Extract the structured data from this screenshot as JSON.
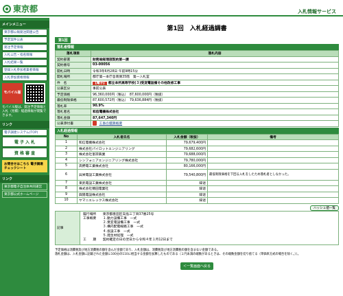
{
  "header": {
    "logo_text": "東京都",
    "service_title": "入札情報サービス"
  },
  "sidebar": {
    "menu_heading": "メインメニュー",
    "items": [
      "東京都公報発注関連公告",
      "予定案件公表",
      "発注予定情報",
      "入札公告・指名情報",
      "入札結果一覧",
      "登録入札参加者業者情報",
      "入札参加資格情報"
    ],
    "mobile_label": "モバイル版",
    "mobile_note": "モバイル版は、発注予定情報と入札（見積）経過情報が閲覧できます。",
    "links_heading": "リンク",
    "big_items": [
      "電子調達システム(TOP)",
      "電 子 入 札",
      "資 格 審 査"
    ],
    "check_label": "お問合せはこちら 電子調達チェックシート",
    "bottom_heading": "リンク",
    "bottom_links": [
      "東京都電子自治体共同運営",
      "東京都公式ホームページ"
    ]
  },
  "main": {
    "page_title": "第1回　入札経過調書",
    "tab_label": "第1回",
    "section_info": "落札者情報",
    "info_headers": [
      "落札項目",
      "落札内容"
    ],
    "info_rows": [
      {
        "k": "契約部署",
        "v": "財務局経理部契約第一課"
      },
      {
        "k": "契約番号",
        "v": "03-00056"
      },
      {
        "k": "開札日時",
        "v": "令和3年6月28日 午前9時15分"
      },
      {
        "k": "開札場所",
        "v": "都庁第一本庁舎南側35階　第一入札室"
      },
      {
        "k": "件　名",
        "badge": "【電子】",
        "v": "都立本所高等学校(３)受変電設備その他改修工事"
      },
      {
        "k": "公表区分",
        "v": "事前公表"
      },
      {
        "k": "予定価格",
        "v": "96,360,000円（税込）　87,600,000円（税抜）"
      },
      {
        "k": "最低制限価格",
        "v": "87,600,572円（税込）　79,636,884円（税抜）"
      },
      {
        "k": "落札率",
        "v": "90.9%"
      },
      {
        "k": "落札者名",
        "v": "和信電機株式会社"
      },
      {
        "k": "落札金額",
        "v": "87,647,340円"
      },
      {
        "k": "公表添付書",
        "v": "工事の積算概要"
      }
    ],
    "section_bids": "入札経過情報",
    "bid_headers": [
      "No",
      "入札者氏名",
      "入札金額（税抜）",
      "備考"
    ],
    "bids": [
      {
        "no": "1",
        "name": "和信電機株式会社",
        "amt": "79,679,400円",
        "note": ""
      },
      {
        "no": "2",
        "name": "株式会社パイロットエンジニアリング",
        "amt": "79,682,600円",
        "note": ""
      },
      {
        "no": "3",
        "name": "株式会社峯岸興業",
        "amt": "79,688,000円",
        "note": ""
      },
      {
        "no": "4",
        "name": "シンフォニアエンジニアリング株式会社",
        "amt": "79,780,000円",
        "note": ""
      },
      {
        "no": "5",
        "name": "高野電工業株式会社",
        "amt": "80,166,000円",
        "note": ""
      },
      {
        "no": "6",
        "name": "呉栄電設工業株式会社",
        "amt": "79,540,800円",
        "note": "最低制限価格を下回る入札をしたため落札者としなかった。"
      },
      {
        "no": "7",
        "name": "東武電設工業株式会社",
        "amt": "辞退",
        "note": ""
      },
      {
        "no": "8",
        "name": "株式会社穂田電業社",
        "amt": "辞退",
        "note": ""
      },
      {
        "no": "9",
        "name": "興陽電設株式会社",
        "amt": "辞退",
        "note": ""
      },
      {
        "no": "10",
        "name": "ヤマニエレックス株式会社",
        "amt": "辞退",
        "note": ""
      }
    ],
    "legend_button": "ハッシュ値一覧",
    "remarks_label": "記事",
    "remarks_text": "履行場所　　東京都墨田区向島三丁目37番25号\n工事概要　　１.動力設備工事　一式\n　　　　　　２.受変電設備工事　一式\n　　　　　　３.構内配電線路工事　一式\n　　　　　　４.仮設工事　一式\n　　　　　　５.発生材処理　一式\n工　　期　　契約確定の日の翌日から令和４年１月12日まで",
    "footnote": "予定価格は消費税及び地方消費税の額を含んだ金額であり、入札金額は、消費税及び地方消費税の額を含まない金額である。\n落札金額は、入札金額に記載された金額に100分の110に相当する金額を加算したものである（１円未満の端数があるときは、その端数金額を切り捨てる（単価率方式の場合を除く。））。",
    "back_button": "＜一覧画面へ戻る"
  }
}
